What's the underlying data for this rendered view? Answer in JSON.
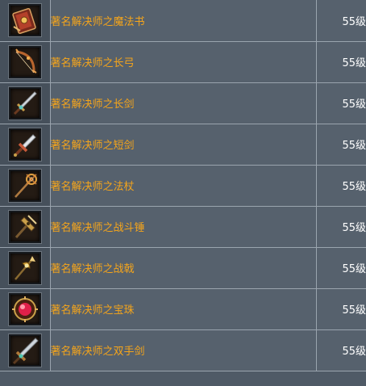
{
  "items": [
    {
      "name": "著名解决师之魔法书",
      "level": "55级",
      "icon": "magic-book-icon",
      "accent": "#c9482a"
    },
    {
      "name": "著名解决师之长弓",
      "level": "55级",
      "icon": "longbow-icon",
      "accent": "#b8652e"
    },
    {
      "name": "著名解决师之长剑",
      "level": "55级",
      "icon": "long-sword-icon",
      "accent": "#5ec9c4"
    },
    {
      "name": "著名解决师之短剑",
      "level": "55级",
      "icon": "short-sword-icon",
      "accent": "#c85a3a"
    },
    {
      "name": "著名解决师之法杖",
      "level": "55级",
      "icon": "staff-icon",
      "accent": "#e0a040"
    },
    {
      "name": "著名解决师之战斗锤",
      "level": "55级",
      "icon": "war-hammer-icon",
      "accent": "#c9a04a"
    },
    {
      "name": "著名解决师之战戟",
      "level": "55级",
      "icon": "halberd-icon",
      "accent": "#d6a23a"
    },
    {
      "name": "著名解决师之宝珠",
      "level": "55级",
      "icon": "orb-icon",
      "accent": "#e0204a"
    },
    {
      "name": "著名解决师之双手剑",
      "level": "55级",
      "icon": "two-handed-sword-icon",
      "accent": "#4fc7b0"
    }
  ]
}
